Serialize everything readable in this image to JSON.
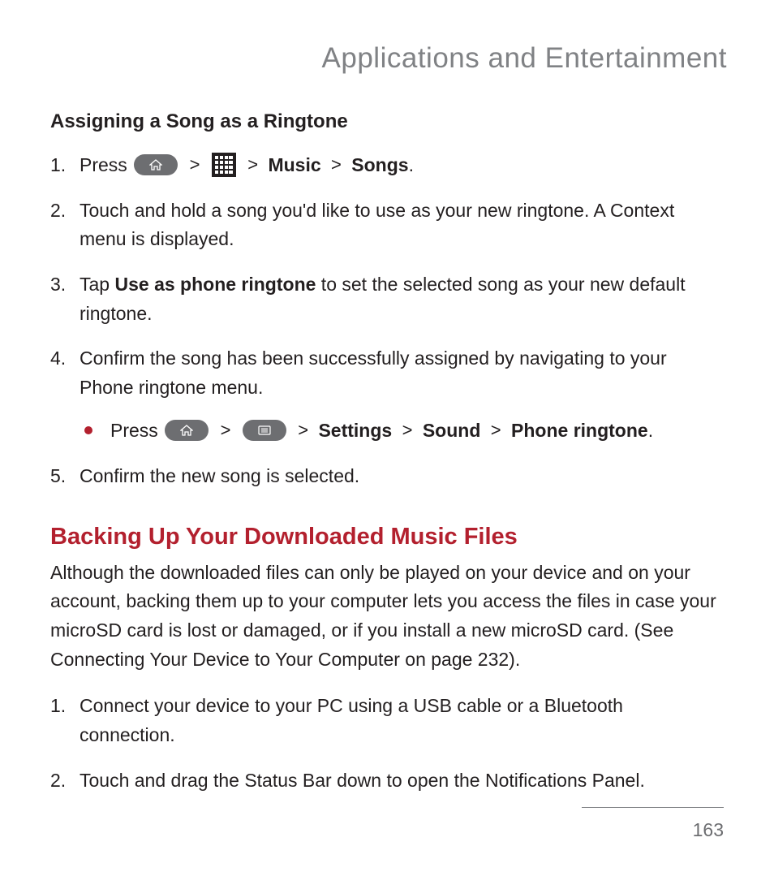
{
  "chapter_title": "Applications and Entertainment",
  "section1": {
    "heading": "Assigning a Song as a Ringtone",
    "steps": {
      "s1_prefix": "Press ",
      "s1_path_music": "Music",
      "s1_path_songs": "Songs",
      "s2": "Touch and hold a song you'd like to use as your new ringtone. A Context menu is displayed.",
      "s3_prefix": "Tap ",
      "s3_bold": "Use as phone ringtone",
      "s3_suffix": " to set the selected song as your new default ringtone.",
      "s4": "Confirm the song has been successfully assigned by navigating to your Phone ringtone menu.",
      "s4_sub_prefix": "Press ",
      "s4_sub_settings": "Settings",
      "s4_sub_sound": "Sound",
      "s4_sub_ringtone": "Phone ringtone",
      "s5": "Confirm the new song is selected."
    }
  },
  "section2": {
    "title": "Backing Up Your Downloaded Music Files",
    "para": "Although the downloaded  files can only be played on your device and on your account, backing them up to your computer lets you access the files in case your microSD card is lost or damaged, or if you install a new microSD card. (See Connecting Your Device to Your Computer on page 232).",
    "steps": {
      "s1": "Connect your device to your PC using a USB cable or a Bluetooth connection.",
      "s2": "Touch and drag the Status Bar down to open the Notifications Panel."
    }
  },
  "gt": ">",
  "page_number": "163"
}
